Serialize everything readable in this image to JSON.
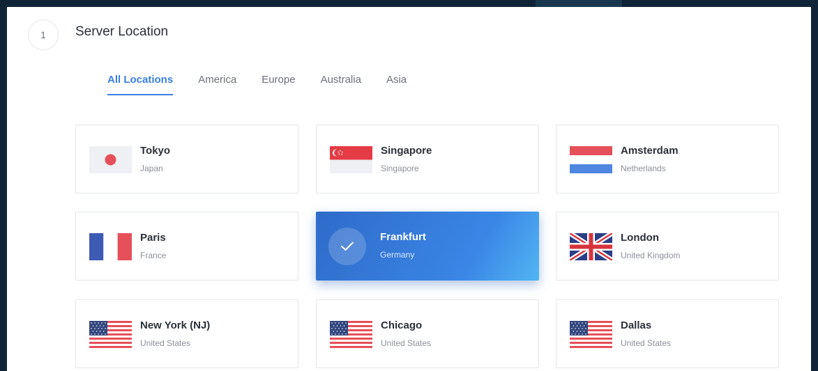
{
  "step": {
    "number": "1",
    "title": "Server Location"
  },
  "tabs": [
    {
      "label": "All Locations",
      "active": true
    },
    {
      "label": "America",
      "active": false
    },
    {
      "label": "Europe",
      "active": false
    },
    {
      "label": "Australia",
      "active": false
    },
    {
      "label": "Asia",
      "active": false
    }
  ],
  "locations": [
    {
      "city": "Tokyo",
      "country": "Japan",
      "flag": "japan-flag-icon",
      "selected": false
    },
    {
      "city": "Singapore",
      "country": "Singapore",
      "flag": "singapore-flag-icon",
      "selected": false
    },
    {
      "city": "Amsterdam",
      "country": "Netherlands",
      "flag": "netherlands-flag-icon",
      "selected": false
    },
    {
      "city": "Paris",
      "country": "France",
      "flag": "france-flag-icon",
      "selected": false
    },
    {
      "city": "Frankfurt",
      "country": "Germany",
      "flag": "check-icon",
      "selected": true
    },
    {
      "city": "London",
      "country": "United Kingdom",
      "flag": "uk-flag-icon",
      "selected": false
    },
    {
      "city": "New York (NJ)",
      "country": "United States",
      "flag": "us-flag-icon",
      "selected": false
    },
    {
      "city": "Chicago",
      "country": "United States",
      "flag": "us-flag-icon",
      "selected": false
    },
    {
      "city": "Dallas",
      "country": "United States",
      "flag": "us-flag-icon",
      "selected": false
    }
  ],
  "colors": {
    "accent": "#3a7fe0",
    "selected_gradient_start": "#2f6bc9",
    "selected_gradient_end": "#52b5f2",
    "background": "#0f2436"
  }
}
